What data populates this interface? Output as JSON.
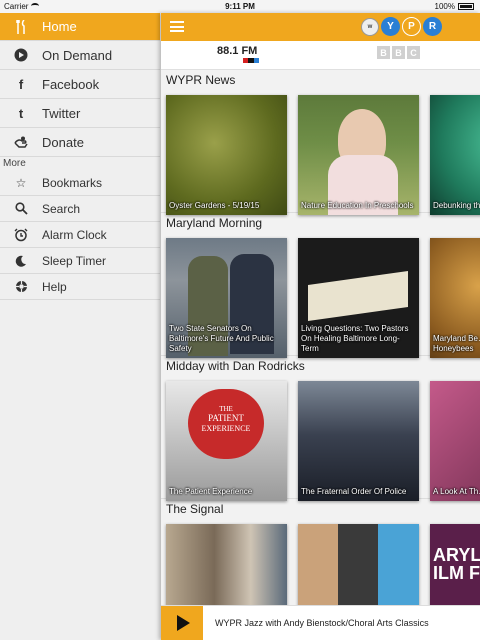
{
  "status": {
    "carrier": "Carrier",
    "time": "9:11 PM",
    "battery": "100%"
  },
  "sidebar": {
    "items": [
      {
        "label": "Home",
        "icon": "home-icon"
      },
      {
        "label": "On Demand",
        "icon": "play-circle-icon"
      },
      {
        "label": "Facebook",
        "icon": "facebook-icon"
      },
      {
        "label": "Twitter",
        "icon": "twitter-icon"
      },
      {
        "label": "Donate",
        "icon": "donate-icon"
      }
    ],
    "more_label": "More",
    "more_items": [
      {
        "label": "Bookmarks",
        "icon": "star-icon"
      },
      {
        "label": "Search",
        "icon": "search-icon"
      },
      {
        "label": "Alarm Clock",
        "icon": "alarm-clock-icon"
      },
      {
        "label": "Sleep Timer",
        "icon": "moon-icon"
      },
      {
        "label": "Help",
        "icon": "help-icon"
      }
    ]
  },
  "header": {
    "logo_letters": [
      "W",
      "Y",
      "P",
      "R"
    ],
    "logo_colors": [
      "#2a7fd4",
      "#2a7fd4",
      "#f0a71e",
      "#2a7fd4"
    ],
    "station": {
      "frequency": "88.1 FM",
      "network": "npr"
    },
    "bbc_letters": [
      "B",
      "B",
      "C"
    ]
  },
  "sections": [
    {
      "title": "WYPR News",
      "cards": [
        {
          "caption": "Oyster Gardens - 5/19/15"
        },
        {
          "caption": "Nature Education In Preschools"
        },
        {
          "caption": "Debunking th… “Cell from H…"
        }
      ]
    },
    {
      "title": "Maryland Morning",
      "cards": [
        {
          "caption": "Two State Senators On Baltimore's Future And Public Safety"
        },
        {
          "caption": "Living Questions: Two Pastors On Healing Baltimore Long-Term"
        },
        {
          "caption": "Maryland Be… 60% Decline… Honeybees"
        }
      ]
    },
    {
      "title": "Midday with Dan Rodricks",
      "cards": [
        {
          "caption": "The Patient Experience"
        },
        {
          "caption": "The Fraternal Order Of Police"
        },
        {
          "caption": "A Look At Th…"
        }
      ]
    },
    {
      "title": "The Signal",
      "cards": [
        {
          "caption": ""
        },
        {
          "caption": ""
        },
        {
          "caption": ""
        }
      ]
    }
  ],
  "patient_art": {
    "line1": "THE",
    "line2": "PATIENT",
    "line3": "EXPERIENCE"
  },
  "signal_art": {
    "line1": "ARYLA",
    "line2": "ILM FE"
  },
  "player": {
    "now_playing": "WYPR Jazz with Andy Bienstock/Choral Arts Classics"
  },
  "colors": {
    "accent": "#f0a71e"
  }
}
